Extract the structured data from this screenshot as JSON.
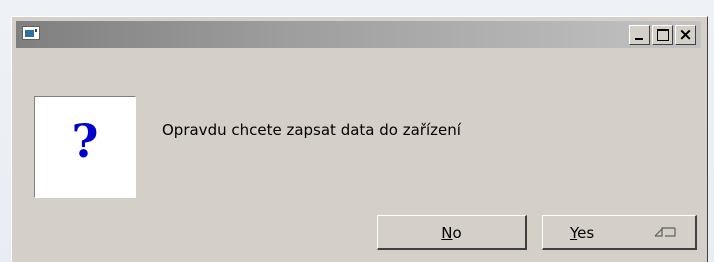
{
  "window": {
    "title": "",
    "icon": "application-icon",
    "controls": {
      "minimize": "minimize-icon",
      "maximize": "maximize-icon",
      "close": "×"
    }
  },
  "dialog": {
    "icon_glyph": "?",
    "message": "Opravdu chcete zapsat data do zařízení",
    "buttons": {
      "no": {
        "mnemonic": "N",
        "rest": "o"
      },
      "yes": {
        "mnemonic": "Y",
        "rest": "es",
        "icon": "enter-key-icon"
      }
    }
  },
  "colors": {
    "dialog_bg": "#d4d0c8",
    "titlebar_start": "#7f7f7f",
    "titlebar_end": "#c3c3c3",
    "question_mark": "#0000cc"
  }
}
